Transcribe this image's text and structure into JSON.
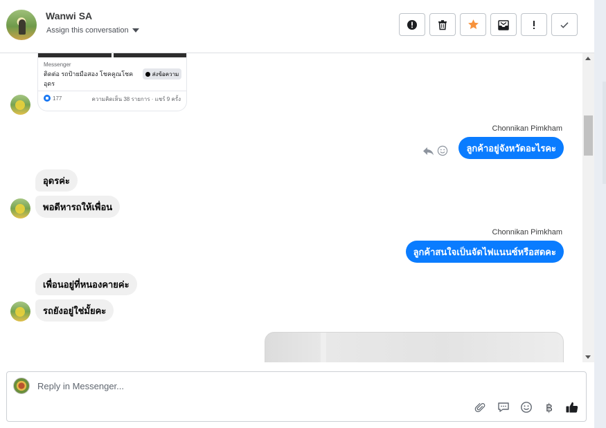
{
  "header": {
    "contact_name": "Wanwi SA",
    "assign_label": "Assign this conversation",
    "actions": [
      {
        "name": "mark-spam",
        "icon": "alert-circle-icon"
      },
      {
        "name": "delete",
        "icon": "trash-icon"
      },
      {
        "name": "star",
        "icon": "star-icon"
      },
      {
        "name": "mark-unread",
        "icon": "envelope-icon"
      },
      {
        "name": "follow-up",
        "icon": "exclamation-icon"
      },
      {
        "name": "mark-done",
        "icon": "check-icon"
      }
    ]
  },
  "shared_card": {
    "source": "Messenger",
    "text": "ติดต่อ รถป้ายมือสอง โชคคูณโชค อุดร",
    "button_label": "ส่งข้อความ",
    "likes": "177",
    "meta": "ความคิดเห็น 38 รายการ · แชร์ 9 ครั้ง"
  },
  "messages": [
    {
      "from": "agent",
      "sender": "Chonnikan Pimkham",
      "text": "ลูกค้าอยู่จังหวัดอะไรคะ"
    },
    {
      "from": "customer",
      "text": "อุดรค่ะ"
    },
    {
      "from": "customer",
      "text": "พอดีหารถให้เพื่อน"
    },
    {
      "from": "agent",
      "sender": "Chonnikan Pimkham",
      "text": "ลูกค้าสนใจเป็นจัดไฟแนนซ์หรือสดคะ"
    },
    {
      "from": "customer",
      "text": "เพื่อนอยู่ที่หนองคายค่ะ"
    },
    {
      "from": "customer",
      "text": "รถยังอยู่ใช่มั้ยคะ"
    }
  ],
  "composer": {
    "placeholder": "Reply in Messenger...",
    "value": "",
    "tools": [
      "paperclip-icon",
      "saved-replies-icon",
      "emoji-icon",
      "baht-icon",
      "thumbs-up-icon"
    ],
    "baht_symbol": "฿"
  },
  "colors": {
    "outgoing_bubble": "#0a7cff",
    "incoming_bubble": "#f0f0f0",
    "star": "#f7923b",
    "like": "#1877f2"
  }
}
